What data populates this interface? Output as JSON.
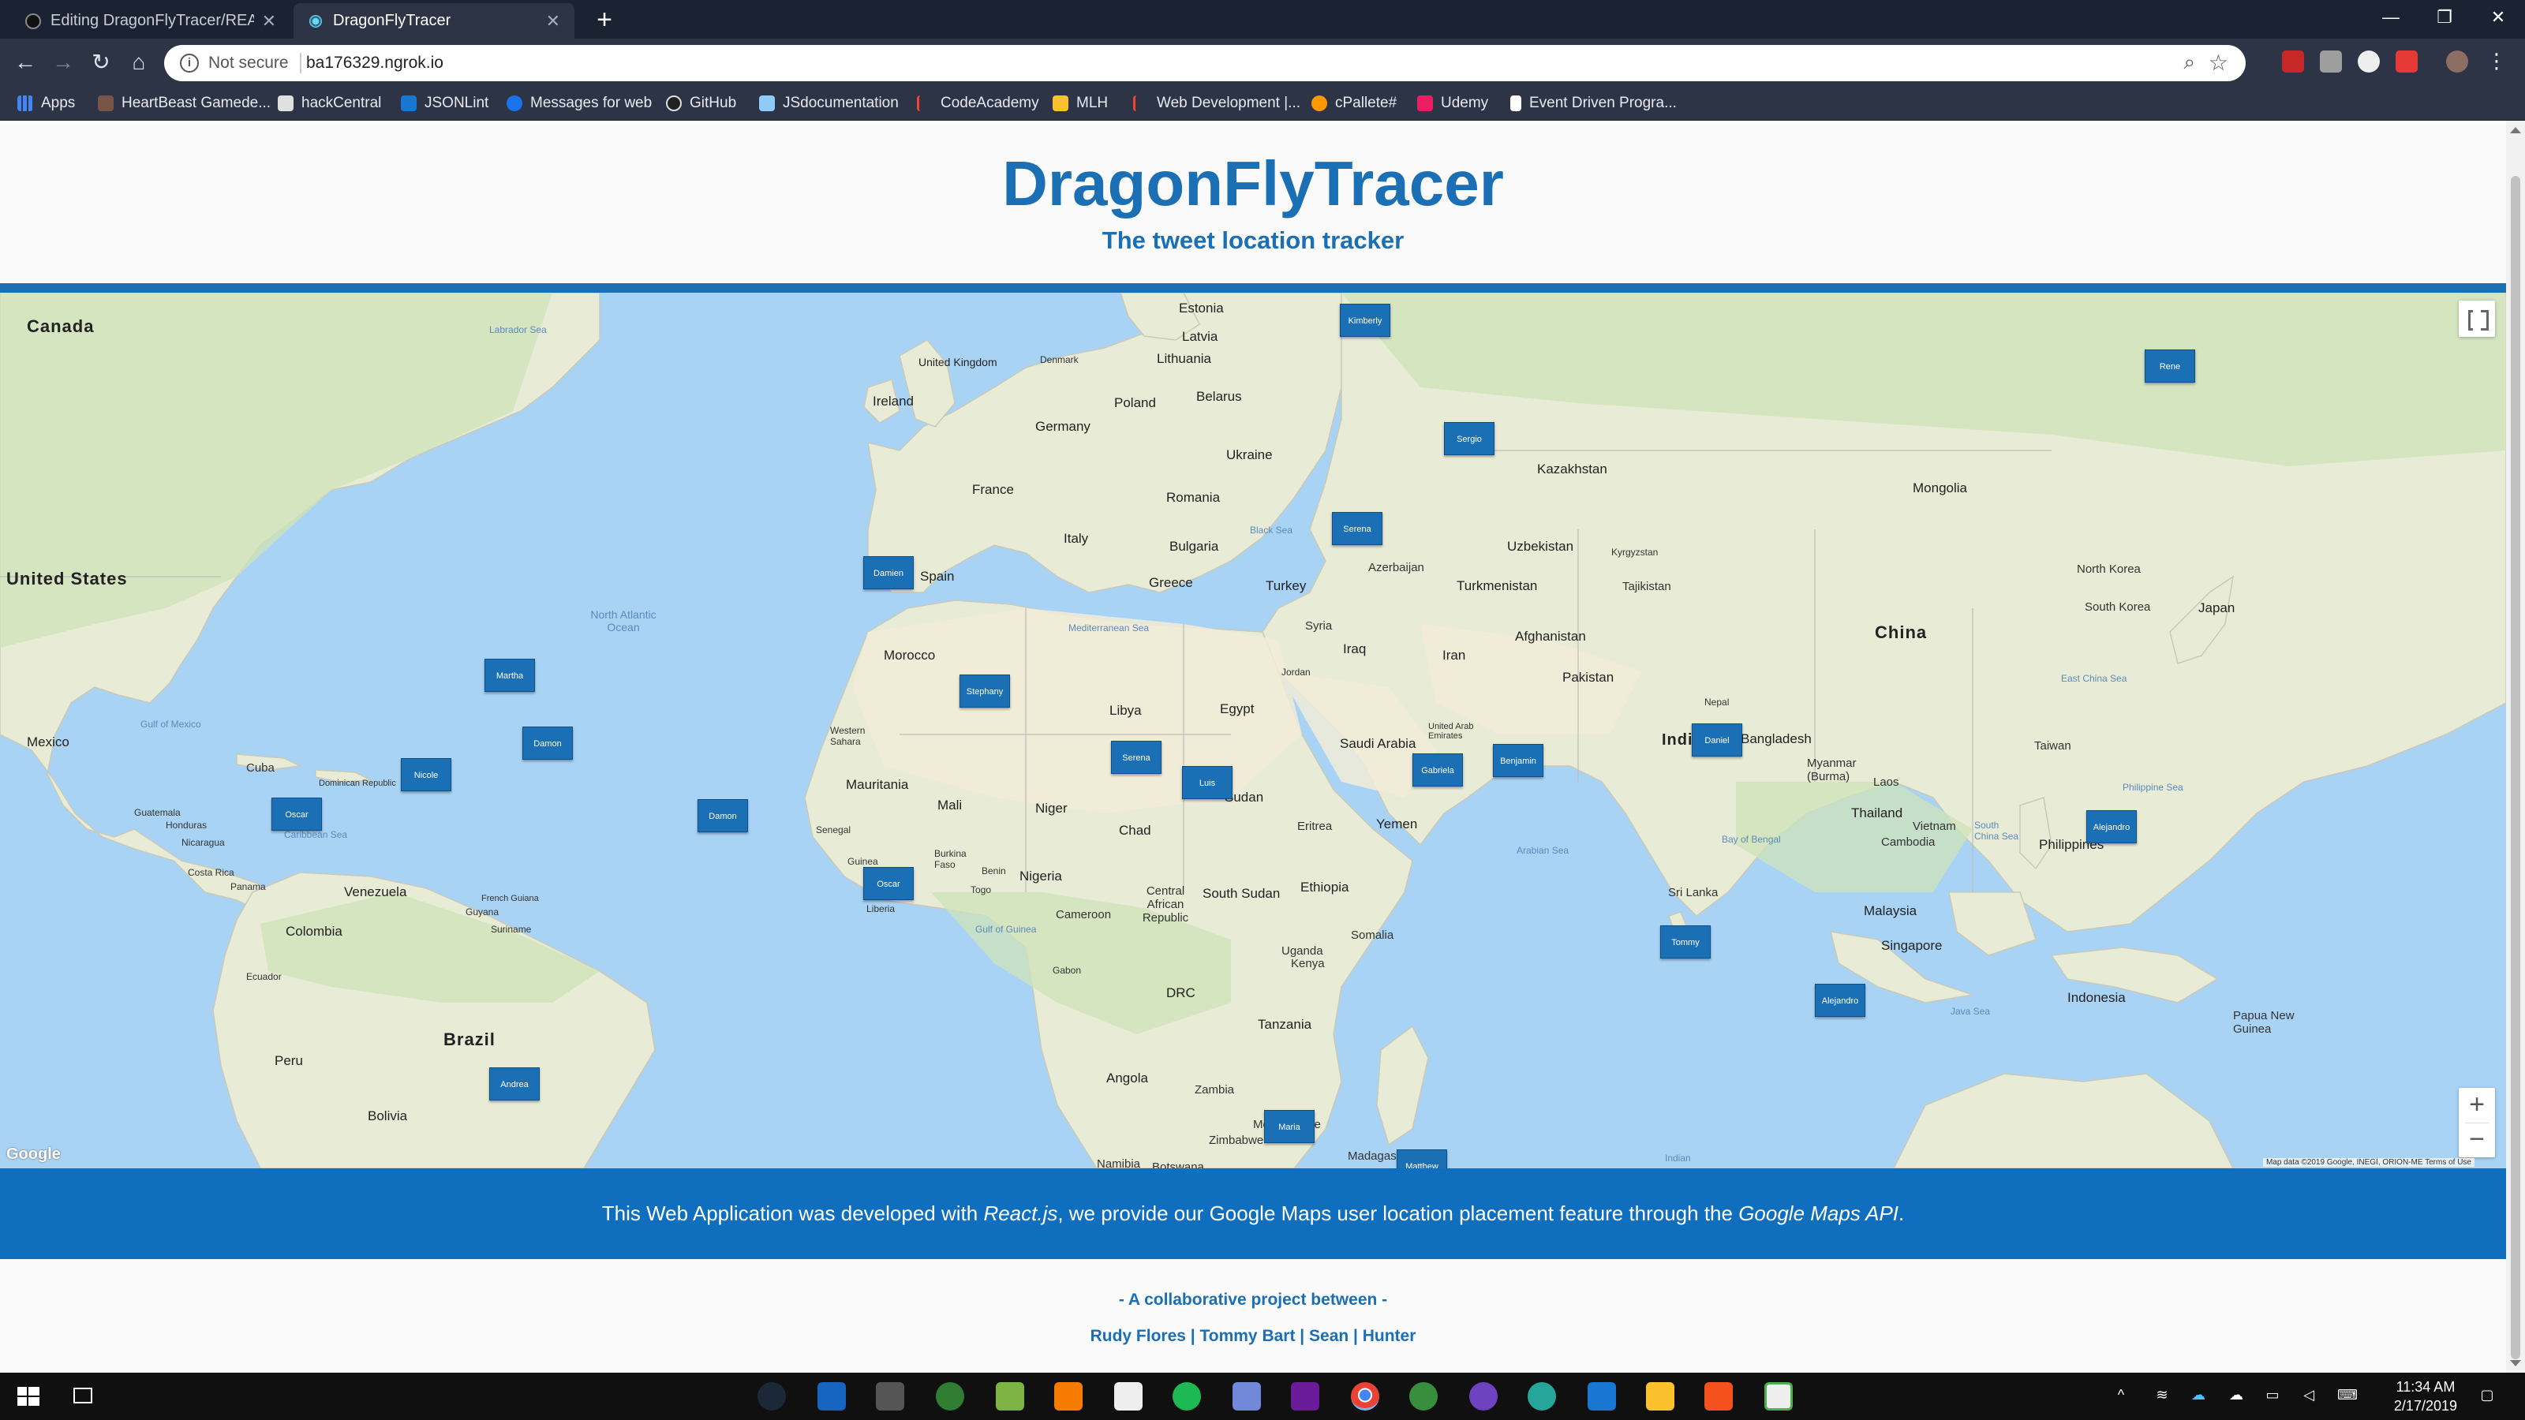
{
  "browser": {
    "tabs": [
      {
        "title": "Editing DragonFlyTracer/README.md",
        "active": false
      },
      {
        "title": "DragonFlyTracer",
        "active": true
      }
    ],
    "address": {
      "security": "Not secure",
      "url": "ba176329.ngrok.io"
    },
    "bookmarks": [
      "Apps",
      "HeartBeast Gamede...",
      "hackCentral",
      "JSONLint",
      "Messages for web",
      "GitHub",
      "JSdocumentation",
      "CodeAcademy",
      "MLH",
      "Web Development |...",
      "cPallete#",
      "Udemy",
      "Event Driven Progra..."
    ]
  },
  "header": {
    "title": "DragonFlyTracer",
    "subtitle": "The tweet location tracker"
  },
  "map": {
    "labels": {
      "canada": "Canada",
      "us": "United States",
      "mexico": "Mexico",
      "cuba": "Cuba",
      "dr": "Dominican Republic",
      "guatemala": "Guatemala",
      "honduras": "Honduras",
      "nicaragua": "Nicaragua",
      "costarica": "Costa Rica",
      "panama": "Panama",
      "venezuela": "Venezuela",
      "colombia": "Colombia",
      "guyana": "Guyana",
      "suriname": "Suriname",
      "frenchguiana": "French Guiana",
      "ecuador": "Ecuador",
      "peru": "Peru",
      "brazil": "Brazil",
      "bolivia": "Bolivia",
      "atlantic": "North Atlantic Ocean",
      "labrador": "Labrador Sea",
      "gulfmexico": "Gulf of Mexico",
      "caribbean": "Caribbean Sea",
      "ireland": "Ireland",
      "uk": "United Kingdom",
      "spain": "Spain",
      "france": "France",
      "germany": "Germany",
      "poland": "Poland",
      "belarus": "Belarus",
      "ukraine": "Ukraine",
      "italy": "Italy",
      "greece": "Greece",
      "turkey": "Turkey",
      "romania": "Romania",
      "bulgaria": "Bulgaria",
      "estonia": "Estonia",
      "latvia": "Latvia",
      "lithuania": "Lithuania",
      "denmark": "Denmark",
      "morocco": "Morocco",
      "wsahara": "Western Sahara",
      "mauritania": "Mauritania",
      "mali": "Mali",
      "niger": "Niger",
      "chad": "Chad",
      "libya": "Libya",
      "egypt": "Egypt",
      "sudan": "Sudan",
      "ssudan": "South Sudan",
      "ethiopia": "Ethiopia",
      "eritrea": "Eritrea",
      "nigeria": "Nigeria",
      "car": "Central African Republic",
      "cameroon": "Cameroon",
      "gabon": "Gabon",
      "drc": "DRC",
      "uganda": "Uganda",
      "kenya": "Kenya",
      "somalia": "Somalia",
      "tanzania": "Tanzania",
      "angola": "Angola",
      "zambia": "Zambia",
      "mozambique": "Mozambique",
      "zimbabwe": "Zimbabwe",
      "madagascar": "Madagascar",
      "namibia": "Namibia",
      "botswana": "Botswana",
      "senegal": "Senegal",
      "guinea": "Guinea",
      "liberia": "Liberia",
      "togo": "Togo",
      "benin": "Benin",
      "burkina": "Burkina Faso",
      "saudi": "Saudi Arabia",
      "yemen": "Yemen",
      "iran": "Iran",
      "iraq": "Iraq",
      "syria": "Syria",
      "jordan": "Jordan",
      "uae": "United Arab Emirates",
      "kazakhstan": "Kazakhstan",
      "uzbekistan": "Uzbekistan",
      "turkmenistan": "Turkmenistan",
      "afghanistan": "Afghanistan",
      "pakistan": "Pakistan",
      "india": "India",
      "nepal": "Nepal",
      "bangladesh": "Bangladesh",
      "myanmar": "Myanmar (Burma)",
      "thailand": "Thailand",
      "laos": "Laos",
      "vietnam": "Vietnam",
      "cambodia": "Cambodia",
      "malaysia": "Malaysia",
      "singapore": "Singapore",
      "indonesia": "Indonesia",
      "philippines": "Philippines",
      "china": "China",
      "mongolia": "Mongolia",
      "nkorea": "North Korea",
      "skorea": "South Korea",
      "japan": "Japan",
      "taiwan": "Taiwan",
      "srilanka": "Sri Lanka",
      "png": "Papua New Guinea",
      "kyrgyzstan": "Kyrgyzstan",
      "tajikistan": "Tajikistan",
      "azerbaijan": "Azerbaijan",
      "mediterranean": "Mediterranean Sea",
      "blacksea": "Black Sea",
      "arabiansea": "Arabian Sea",
      "bayofbengal": "Bay of Bengal",
      "southchinasea": "South China Sea",
      "eastchinasea": "East China Sea",
      "philippinesea": "Philippine Sea",
      "java": "Java Sea",
      "indian": "Indian",
      "gulfguinea": "Gulf of Guinea"
    },
    "pins": [
      "Kimberly",
      "Rene",
      "Sergio",
      "Serena",
      "Damien",
      "Martha",
      "Damon",
      "Nicole",
      "Oscar",
      "Damon",
      "Stephany",
      "Serena",
      "Luis",
      "Oscar",
      "Gabriela",
      "Benjamin",
      "Daniel",
      "Alejandro",
      "Tommy",
      "Alejandro",
      "Andrea",
      "Maria",
      "Matthew"
    ],
    "google": "Google",
    "attribution": "Map data ©2019 Google, INEGI, ORION-ME   Terms of Use"
  },
  "footer": {
    "before": "This Web Application was developed with ",
    "react": "React.js",
    "middle": ", we provide our Google Maps user location placement feature through the ",
    "api": "Google Maps API",
    "after": ".",
    "collab": "- A collaborative project between -",
    "authors": "Rudy Flores | Tommy Bart | Sean | Hunter"
  },
  "taskbar": {
    "time": "11:34 AM",
    "date": "2/17/2019"
  }
}
